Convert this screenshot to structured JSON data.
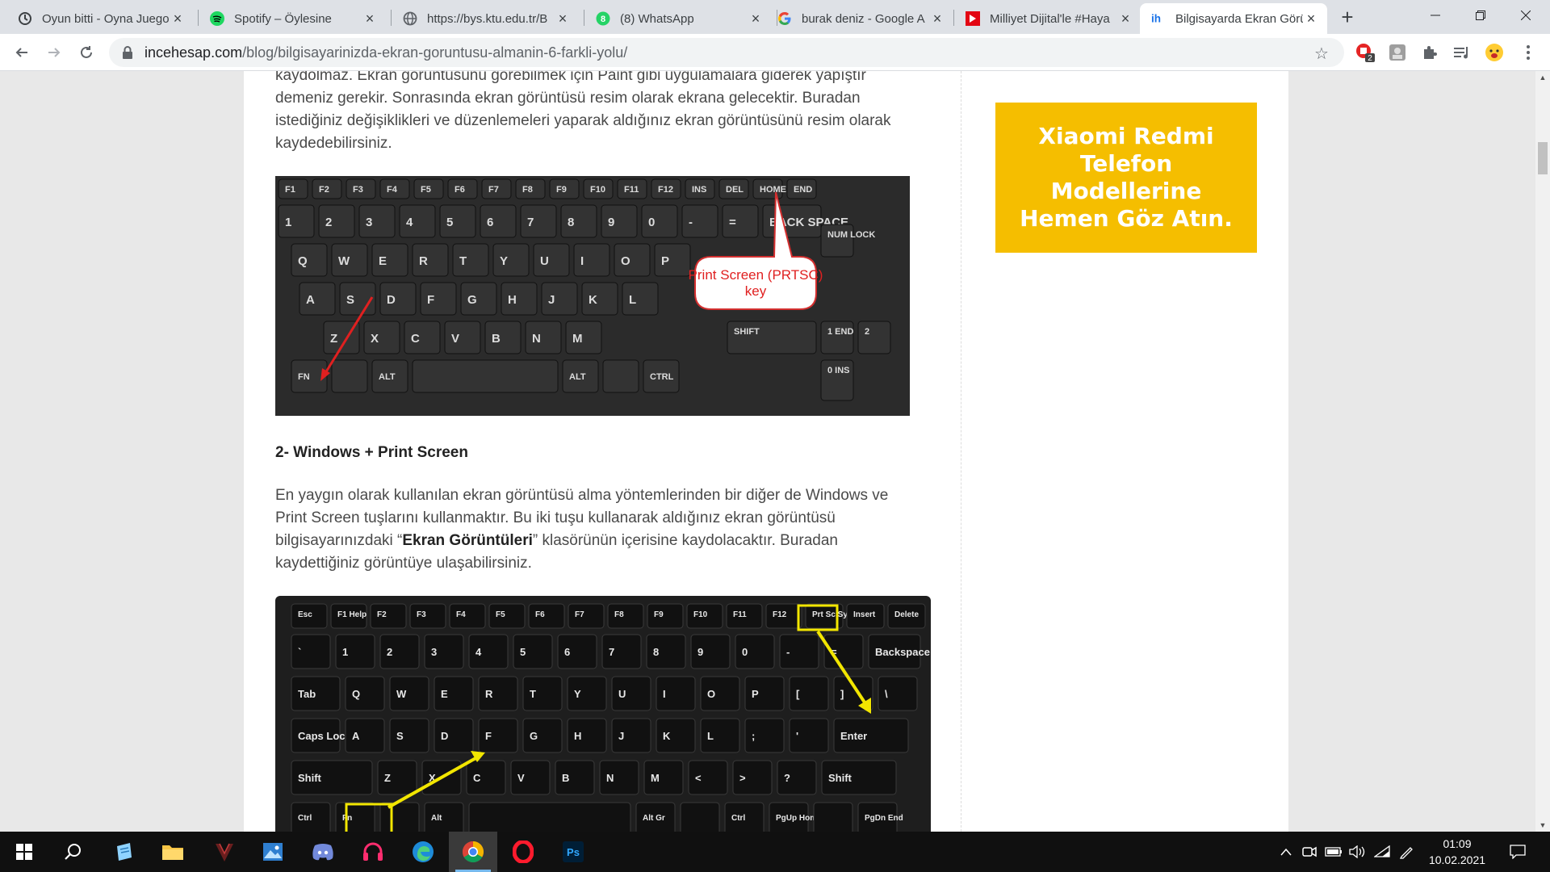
{
  "tabs": [
    {
      "title": "Oyun bitti - Oyna Juegos",
      "icon": "game-icon"
    },
    {
      "title": "Spotify – Öylesine",
      "icon": "spotify-icon"
    },
    {
      "title": "https://bys.ktu.edu.tr/B",
      "icon": "globe-icon"
    },
    {
      "title": "(8) WhatsApp",
      "icon": "whatsapp-icon"
    },
    {
      "title": "burak deniz - Google A",
      "icon": "google-icon"
    },
    {
      "title": "Milliyet Dijital'le #Haya",
      "icon": "milliyet-icon"
    },
    {
      "title": "Bilgisayarda Ekran Görü",
      "icon": "incehesap-icon"
    }
  ],
  "omnibox": {
    "domain": "incehesap.com",
    "path": "/blog/bilgisayarinizda-ekran-goruntusu-almanin-6-farkli-yolu/"
  },
  "extensions": {
    "badge_count": "2"
  },
  "article": {
    "p1": "kaydolmaz. Ekran görüntüsünü görebilmek için Paint gibi uygulamalara giderek yapıştır demeniz gerekir. Sonrasında ekran görüntüsü resim olarak ekrana gelecektir. Buradan istediğiniz değişiklikleri ve düzenlemeleri yaparak aldığınız ekran görüntüsünü resim olarak kaydedebilirsiniz.",
    "image1_callout": "Print Screen (PRTSC) key",
    "heading2": "2- Windows + Print Screen",
    "p2_before": "En yaygın olarak kullanılan ekran görüntüsü alma yöntemlerinden bir diğer de Windows ve Print Screen tuşlarını kullanmaktır. Bu iki tuşu kullanarak aldığınız ekran görüntüsü bilgisayarınızdaki “",
    "p2_bold": "Ekran Görüntüleri",
    "p2_after": "” klasörünün içerisine kaydolacaktır. Buradan kaydettiğiniz görüntüye ulaşabilirsiniz."
  },
  "keyboard1": {
    "fn_row": [
      "F1",
      "F2",
      "F3",
      "F4",
      "F5",
      "F6",
      "F7",
      "F8",
      "F9",
      "F10",
      "F11",
      "F12",
      "INS",
      "DEL",
      "HOME",
      "END"
    ],
    "num_row": [
      "1",
      "2",
      "3",
      "4",
      "5",
      "6",
      "7",
      "8",
      "9",
      "0",
      "-",
      "=",
      "BACK SPACE"
    ],
    "q_row": [
      "Q",
      "W",
      "E",
      "R",
      "T",
      "Y",
      "U",
      "I",
      "O",
      "P"
    ],
    "a_row": [
      "A",
      "S",
      "D",
      "F",
      "G",
      "H",
      "J",
      "K",
      "L"
    ],
    "z_row": [
      "Z",
      "X",
      "C",
      "V",
      "B",
      "N",
      "M"
    ],
    "bottom_row": [
      "FN",
      "",
      "ALT",
      "",
      "ALT",
      "",
      "CTRL"
    ],
    "extras": [
      "NUM LOCK",
      "SHIFT",
      "1 END",
      "2",
      "0 INS"
    ]
  },
  "keyboard2": {
    "fn_row": [
      "Esc",
      "F1 Help",
      "F2",
      "F3",
      "F4",
      "F5",
      "F6",
      "F7",
      "F8",
      "F9",
      "F10",
      "F11",
      "F12",
      "Prt Sc Sys Rq",
      "Insert",
      "Delete"
    ],
    "num_row": [
      "`",
      "1",
      "2",
      "3",
      "4",
      "5",
      "6",
      "7",
      "8",
      "9",
      "0",
      "-",
      "=",
      "Backspace"
    ],
    "q_row": [
      "Tab",
      "Q",
      "W",
      "E",
      "R",
      "T",
      "Y",
      "U",
      "I",
      "O",
      "P",
      "[",
      "]",
      "\\"
    ],
    "a_row": [
      "Caps Lock",
      "A",
      "S",
      "D",
      "F",
      "G",
      "H",
      "J",
      "K",
      "L",
      ";",
      "'",
      "Enter"
    ],
    "z_row": [
      "Shift",
      "Z",
      "X",
      "C",
      "V",
      "B",
      "N",
      "M",
      "<",
      ">",
      "?",
      "Shift"
    ],
    "bottom_row": [
      "Ctrl",
      "Fn",
      "",
      "Alt",
      "",
      "Alt Gr",
      "",
      "Ctrl",
      "PgUp Home",
      "",
      "PgDn End"
    ]
  },
  "ad": {
    "text": "Xiaomi Redmi Telefon Modellerine Hemen Göz Atın."
  },
  "taskbar": {
    "time": "01:09",
    "date": "10.02.2021"
  },
  "colors": {
    "ad_bg": "#f5be00",
    "scroll_top": "#2e78c2",
    "callout_text": "#e02020",
    "highlight": "#f2e600"
  }
}
